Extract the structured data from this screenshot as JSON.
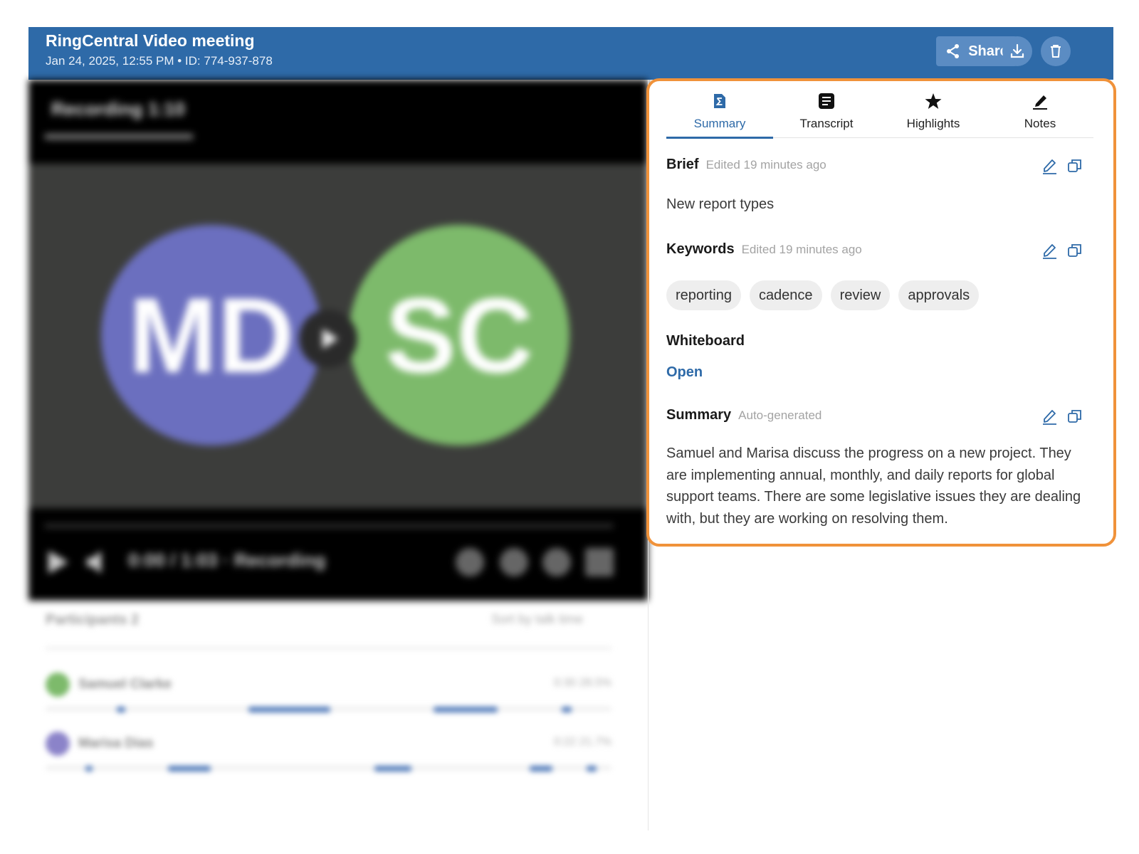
{
  "header": {
    "title": "RingCentral Video meeting",
    "meta": "Jan 24, 2025, 12:55 PM • ID: 774-937-878",
    "share_label": "Share"
  },
  "video": {
    "top_label": "Recording 1:10",
    "avatar_left": "MD",
    "avatar_right": "SC",
    "controls_label": "0:00 / 1:03 · Recording",
    "avatar_left_color": "#6b6fbf",
    "avatar_right_color": "#7dba6b"
  },
  "participants": {
    "heading": "Participants 2",
    "sort_label": "Sort by talk time",
    "rows": [
      {
        "name": "Samuel Clarke",
        "stat": "0:30  28.5%",
        "color": "#7dba6b"
      },
      {
        "name": "Marisa Dias",
        "stat": "0:22  21.7%",
        "color": "#8b83c9"
      }
    ]
  },
  "tabs": [
    {
      "label": "Summary",
      "icon": "summary-icon",
      "active": true
    },
    {
      "label": "Transcript",
      "icon": "transcript-icon",
      "active": false
    },
    {
      "label": "Highlights",
      "icon": "star-icon",
      "active": false
    },
    {
      "label": "Notes",
      "icon": "pen-icon",
      "active": false
    }
  ],
  "brief": {
    "title": "Brief",
    "subtitle": "Edited 19 minutes ago",
    "text": "New report types"
  },
  "keywords": {
    "title": "Keywords",
    "subtitle": "Edited 19 minutes ago",
    "items": [
      "reporting",
      "cadence",
      "review",
      "approvals"
    ]
  },
  "whiteboard": {
    "title": "Whiteboard",
    "link": "Open"
  },
  "summary": {
    "title": "Summary",
    "subtitle": "Auto-generated",
    "text": "Samuel and Marisa discuss the progress on a new project. They are implementing annual, monthly, and daily reports for global support teams. There are some legislative issues they are dealing with, but they are working on resolving them."
  },
  "colors": {
    "header_bg": "#2e6aa8",
    "accent": "#2e6aa8",
    "panel_border": "#f0923a"
  }
}
